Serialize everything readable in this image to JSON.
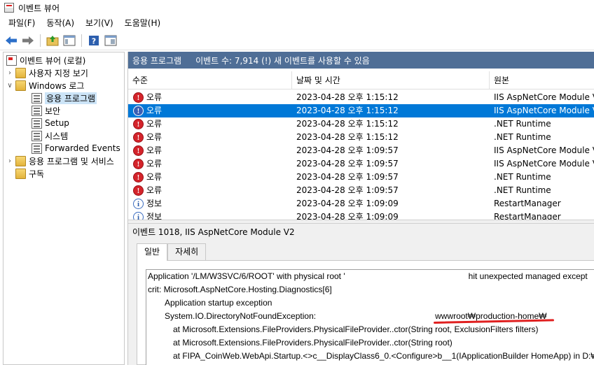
{
  "window": {
    "title": "이벤트 뷰어"
  },
  "menu": {
    "items": [
      "파일(F)",
      "동작(A)",
      "보기(V)",
      "도움말(H)"
    ]
  },
  "toolbar": {
    "icons": [
      "back-icon",
      "forward-icon",
      "up-icon",
      "show-hide-tree-icon",
      "help-icon",
      "properties-icon"
    ]
  },
  "tree": {
    "root": "이벤트 뷰어 (로컬)",
    "custom_views": "사용자 지정 보기",
    "windows_logs": "Windows 로그",
    "children": [
      "응용 프로그램",
      "보안",
      "Setup",
      "시스템",
      "Forwarded Events"
    ],
    "app_services": "응용 프로그램 및 서비스",
    "subscriptions": "구독"
  },
  "panel": {
    "title": "응용 프로그램",
    "count": "이벤트 수: 7,914 (!) 새 이벤트를 사용할 수 있음"
  },
  "columns": {
    "level": "수준",
    "datetime": "날짜 및 시간",
    "source": "원본"
  },
  "events": [
    {
      "icon": "error-icon",
      "level": "오류",
      "datetime": "2023-04-28 오후 1:15:12",
      "source": "IIS AspNetCore Module V2"
    },
    {
      "icon": "error-icon",
      "level": "오류",
      "datetime": "2023-04-28 오후 1:15:12",
      "source": "IIS AspNetCore Module V2"
    },
    {
      "icon": "error-icon",
      "level": "오류",
      "datetime": "2023-04-28 오후 1:15:12",
      "source": ".NET Runtime"
    },
    {
      "icon": "error-icon",
      "level": "오류",
      "datetime": "2023-04-28 오후 1:15:12",
      "source": ".NET Runtime"
    },
    {
      "icon": "error-icon",
      "level": "오류",
      "datetime": "2023-04-28 오후 1:09:57",
      "source": "IIS AspNetCore Module V2"
    },
    {
      "icon": "error-icon",
      "level": "오류",
      "datetime": "2023-04-28 오후 1:09:57",
      "source": "IIS AspNetCore Module V2"
    },
    {
      "icon": "error-icon",
      "level": "오류",
      "datetime": "2023-04-28 오후 1:09:57",
      "source": ".NET Runtime"
    },
    {
      "icon": "error-icon",
      "level": "오류",
      "datetime": "2023-04-28 오후 1:09:57",
      "source": ".NET Runtime"
    },
    {
      "icon": "info-icon",
      "level": "정보",
      "datetime": "2023-04-28 오후 1:09:09",
      "source": "RestartManager"
    },
    {
      "icon": "info-icon",
      "level": "정보",
      "datetime": "2023-04-28 오후 1:09:09",
      "source": "RestartManager"
    }
  ],
  "selected_row": 1,
  "detail": {
    "title": "이벤트 1018, IIS AspNetCore Module V2",
    "tabs": [
      "일반",
      "자세히"
    ],
    "lines": [
      {
        "prefix": "Application '/LM/W3SVC/6/ROOT' with physical root '",
        "suffix": "hit unexpected managed except"
      },
      {
        "text": "crit: Microsoft.AspNetCore.Hosting.Diagnostics[6]"
      },
      {
        "text": "Application startup exception"
      },
      {
        "prefix": "System.IO.DirectoryNotFoundException:",
        "suffix": "wwwroot₩production-home₩"
      },
      {
        "text": "at Microsoft.Extensions.FileProviders.PhysicalFileProvider..ctor(String root, ExclusionFilters filters)"
      },
      {
        "text": "at Microsoft.Extensions.FileProviders.PhysicalFileProvider..ctor(String root)"
      },
      {
        "text": "at FIPA_CoinWeb.WebApi.Startup.<>c__DisplayClass6_0.<Configure>b__1(IApplicationBuilder HomeApp) in D:₩"
      }
    ]
  },
  "colors": {
    "header_bar": "#4f6e96",
    "selection": "#0078d7",
    "error_icon": "#d4242b",
    "annotation": "#e02020"
  }
}
